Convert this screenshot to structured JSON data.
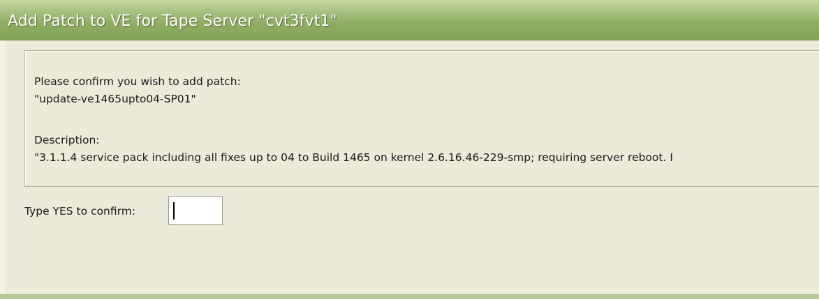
{
  "window": {
    "title": "Add Patch to VE for Tape Server \"cvt3fvt1\""
  },
  "confirmation": {
    "prompt": "Please confirm you wish to add patch:",
    "patch_name": "\"update-ve1465upto04-SP01\"",
    "description_label": "Description:",
    "description_text": "\"3.1.1.4 service pack including all fixes up to 04 to Build 1465 on kernel 2.6.16.46-229-smp; requiring server reboot. I"
  },
  "confirm_field": {
    "label": "Type YES to confirm:",
    "value": ""
  },
  "colors": {
    "titlebar_accent": "#8fac63",
    "dialog_background": "#eceada",
    "title_text": "#ffffff"
  }
}
